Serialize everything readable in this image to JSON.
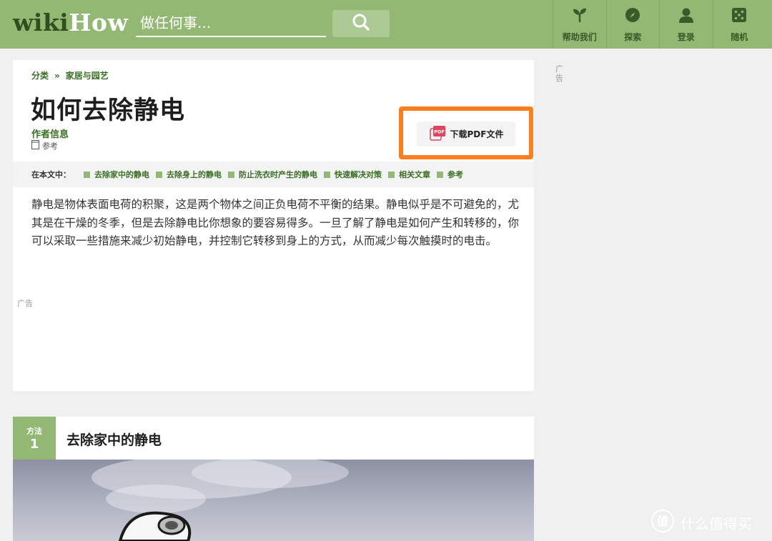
{
  "header": {
    "logo_wiki": "wiki",
    "logo_how": "How",
    "search_placeholder": "做任何事...",
    "nav": [
      {
        "label": "帮助我们",
        "icon": "sprout-icon"
      },
      {
        "label": "探索",
        "icon": "compass-icon"
      },
      {
        "label": "登录",
        "icon": "user-icon"
      },
      {
        "label": "随机",
        "icon": "dice-icon"
      }
    ]
  },
  "breadcrumb": {
    "root": "分类",
    "separator": "»",
    "category": "家居与园艺"
  },
  "article": {
    "title": "如何去除静电",
    "author_label": "作者信息",
    "refs_label": "参考",
    "pdf_label": "下载PDF文件",
    "pdf_icon_text": "PDF",
    "intro": "静电是物体表面电荷的积聚，这是两个物体之间正负电荷不平衡的结果。静电似乎是不可避免的，尤其是在干燥的冬季，但是去除静电比你想象的要容易得多。一旦了解了静电是如何产生和转移的，你可以采取一些措施来减少初始静电，并控制它转移到身上的方式，从而减少每次触摸时的电击。"
  },
  "toc": {
    "label": "在本文中：",
    "items": [
      "去除家中的静电",
      "去除身上的静电",
      "防止洗衣时产生的静电",
      "快速解决对策",
      "相关文章",
      "参考"
    ]
  },
  "ads": {
    "label": "广告",
    "side_label": "广告"
  },
  "method": {
    "badge_top": "方法",
    "badge_num": "1",
    "title": "去除家中的静电"
  },
  "watermark": {
    "text": "什么值得买",
    "logo_glyph": "值"
  },
  "colors": {
    "brand_green": "#93b874",
    "link_green": "#3a6e24",
    "highlight_orange": "#ff7f1e"
  }
}
